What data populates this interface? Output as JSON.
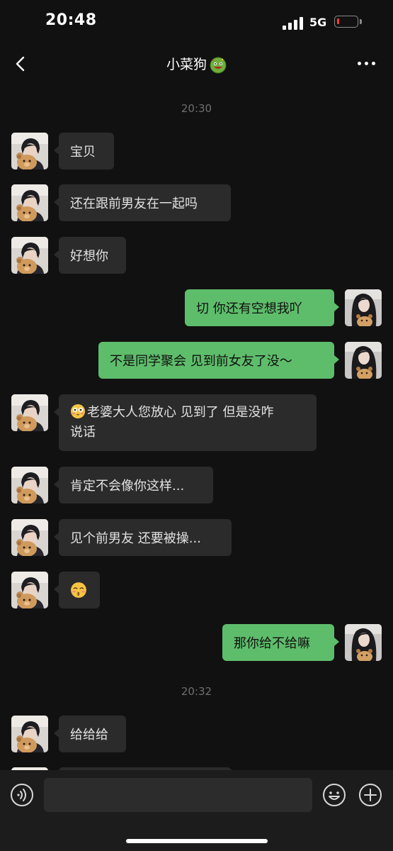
{
  "status_bar": {
    "time": "20:48",
    "network": "5G"
  },
  "header": {
    "title": "小菜狗",
    "title_emoji": "green-smiley-emoji",
    "back_icon": "chevron-left-icon",
    "more_icon": "more-dots-icon"
  },
  "colors": {
    "background": "#111111",
    "incoming_bubble": "#2b2b2b",
    "outgoing_bubble": "#5ebd6b",
    "timestamp": "#6e6e6e"
  },
  "timestamps": [
    "20:30",
    "20:32"
  ],
  "messages": [
    {
      "from": "contact",
      "text": "宝贝"
    },
    {
      "from": "contact",
      "text": "还在跟前男友在一起吗"
    },
    {
      "from": "contact",
      "text": "好想你"
    },
    {
      "from": "me",
      "text": "切 你还有空想我吖"
    },
    {
      "from": "me",
      "text": "不是同学聚会 见到前女友了没～"
    },
    {
      "from": "contact",
      "emoji": "flushed-face-emoji",
      "line1": "老婆大人您放心 见到了 但是没咋",
      "line2": "说话"
    },
    {
      "from": "contact",
      "text": "肯定不会像你这样..."
    },
    {
      "from": "contact",
      "text": "见个前男友 还要被操..."
    },
    {
      "from": "contact",
      "emoji": "kissing-face-emoji",
      "text": ""
    },
    {
      "from": "me",
      "text": "那你给不给嘛"
    },
    {
      "from": "contact",
      "text": "给给给"
    }
  ],
  "input_bar": {
    "placeholder": "",
    "voice_icon": "voice-icon",
    "emoji_icon": "emoji-icon",
    "plus_icon": "plus-icon"
  }
}
